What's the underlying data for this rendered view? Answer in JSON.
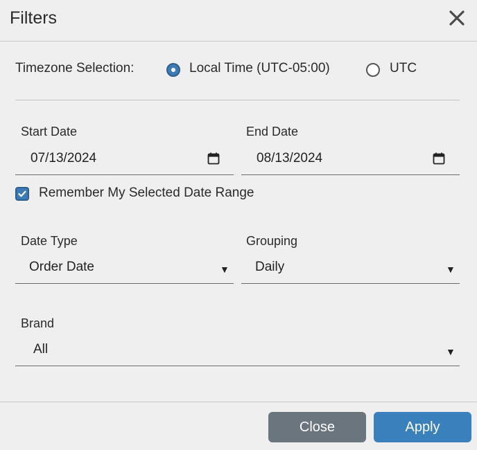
{
  "dialog": {
    "title": "Filters",
    "close_icon": "close-icon"
  },
  "timezone": {
    "label": "Timezone Selection:",
    "options": [
      {
        "label": "Local Time (UTC-05:00)",
        "selected": true
      },
      {
        "label": "UTC",
        "selected": false
      }
    ]
  },
  "dates": {
    "start_label": "Start Date",
    "start_value": "07/13/2024",
    "end_label": "End Date",
    "end_value": "08/13/2024",
    "icon": "calendar-icon"
  },
  "remember": {
    "label": "Remember My Selected Date Range",
    "checked": true
  },
  "date_type": {
    "label": "Date Type",
    "value": "Order Date"
  },
  "grouping": {
    "label": "Grouping",
    "value": "Daily"
  },
  "brand": {
    "label": "Brand",
    "value": "All"
  },
  "caret_glyph": "▼",
  "footer": {
    "close_label": "Close",
    "apply_label": "Apply"
  },
  "colors": {
    "accent": "#3a80bd",
    "secondary_button": "#6b757d",
    "background": "#efefef"
  }
}
